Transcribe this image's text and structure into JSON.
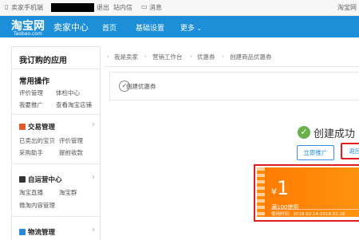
{
  "topbar": {
    "seller_label": "卖家手机端",
    "logout": "退出",
    "messages": "站内信",
    "notices": "消息",
    "right": "淘宝网"
  },
  "header": {
    "logo": "淘宝网",
    "logo_sub": "Taobao.com",
    "center_title": "卖家中心",
    "nav": [
      "首页",
      "基础设置",
      "更多"
    ]
  },
  "sidebar": {
    "title": "我订购的应用",
    "common_ops": {
      "title": "常用操作",
      "items": [
        "评价管理",
        "体检中心",
        "我要推广",
        "查看淘宝店铺"
      ]
    },
    "trade": {
      "title": "交易管理",
      "items": [
        "已卖出的宝贝",
        "评价管理",
        "采购助手",
        "提前收款"
      ]
    },
    "ops": {
      "title": "自运营中心",
      "items": [
        "淘宝直播",
        "淘宝群",
        "微淘内容管理"
      ]
    },
    "logistics": {
      "title": "物流管理"
    }
  },
  "breadcrumb": [
    "我是卖家",
    "营销工作台",
    "优惠券",
    "创建商品优惠券"
  ],
  "steps": {
    "current": "创建优惠券"
  },
  "result": {
    "success_text": "创建成功",
    "promote_button": "立即推广",
    "return_button": "返回"
  },
  "coupon": {
    "currency": "¥",
    "amount": "1",
    "condition": "满100使用",
    "period": "使用时间：2018.02.14-2018.02.18"
  },
  "colors": {
    "header": "#1d8fd8",
    "coupon": "#ff8a00",
    "highlight": "#e02020",
    "success": "#6ab04c"
  }
}
